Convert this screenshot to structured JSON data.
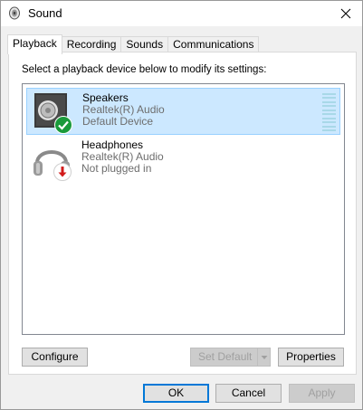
{
  "window": {
    "title": "Sound",
    "close_glyph": "✕"
  },
  "tabs": [
    {
      "label": "Playback",
      "active": true
    },
    {
      "label": "Recording",
      "active": false
    },
    {
      "label": "Sounds",
      "active": false
    },
    {
      "label": "Communications",
      "active": false
    }
  ],
  "panel": {
    "instruction": "Select a playback device below to modify its settings:",
    "devices": [
      {
        "name": "Speakers",
        "driver": "Realtek(R) Audio",
        "status": "Default Device",
        "icon": "speaker-icon",
        "badge": "green-check-badge-icon",
        "selected": true
      },
      {
        "name": "Headphones",
        "driver": "Realtek(R) Audio",
        "status": "Not plugged in",
        "icon": "headphones-icon",
        "badge": "red-down-arrow-badge-icon",
        "selected": false
      }
    ],
    "configure_label": "Configure",
    "set_default_label": "Set Default",
    "properties_label": "Properties"
  },
  "footer": {
    "ok_label": "OK",
    "cancel_label": "Cancel",
    "apply_label": "Apply"
  },
  "colors": {
    "selection_bg": "#cce8ff",
    "selection_border": "#99d1ff",
    "accent": "#0078d7"
  }
}
